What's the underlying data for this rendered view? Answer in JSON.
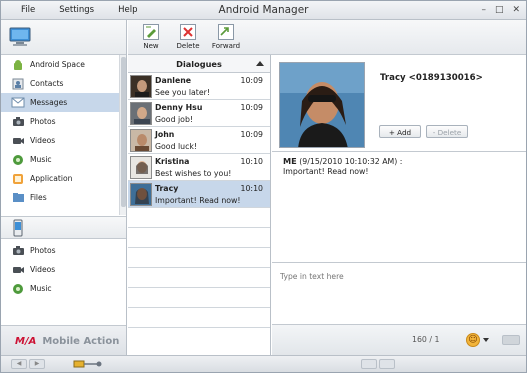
{
  "window": {
    "title": "Android Manager"
  },
  "menu": [
    "File",
    "Settings",
    "Help"
  ],
  "window_buttons": [
    "–",
    "□",
    "✕"
  ],
  "sidebar": {
    "computer_items": [
      {
        "label": "Android Space",
        "icon": "android-icon"
      },
      {
        "label": "Contacts",
        "icon": "contacts-icon"
      },
      {
        "label": "Messages",
        "icon": "envelope-icon",
        "selected": true
      },
      {
        "label": "Photos",
        "icon": "camera-icon"
      },
      {
        "label": "Videos",
        "icon": "video-icon"
      },
      {
        "label": "Music",
        "icon": "music-icon"
      },
      {
        "label": "Application",
        "icon": "application-icon"
      },
      {
        "label": "Files",
        "icon": "files-icon"
      }
    ],
    "phone_items": [
      {
        "label": "Photos",
        "icon": "camera-icon"
      },
      {
        "label": "Videos",
        "icon": "video-icon"
      },
      {
        "label": "Music",
        "icon": "music-icon"
      }
    ],
    "brand": {
      "mark": "M/A",
      "text": "Mobile Action"
    }
  },
  "toolbar": {
    "new_label": "New",
    "delete_label": "Delete",
    "forward_label": "Forward"
  },
  "dialogues": {
    "header": "Dialogues",
    "items": [
      {
        "name": "Danlene",
        "time": "10:09",
        "message": "See you later!"
      },
      {
        "name": "Denny  Hsu",
        "time": "10:09",
        "message": "Good job!"
      },
      {
        "name": "John",
        "time": "10:09",
        "message": "Good luck!"
      },
      {
        "name": "Kristina",
        "time": "10:10",
        "message": "Best wishes to you!"
      },
      {
        "name": "Tracy",
        "time": "10:10",
        "message": "Important! Read now!",
        "selected": true
      }
    ]
  },
  "detail": {
    "contact_name": "Tracy <0189130016>",
    "add_label": "+ Add",
    "delete_label": "- Delete",
    "message": {
      "sender": "ME",
      "timestamp": "(9/15/2010 10:10:32 AM) :",
      "body": "Important! Read now!"
    },
    "compose_placeholder": "Type in text here",
    "char_count": "160 / 1"
  },
  "colors": {
    "selection": "#c7d7ea",
    "border": "#b9c0c8",
    "brand_mark": "#cc1133"
  }
}
